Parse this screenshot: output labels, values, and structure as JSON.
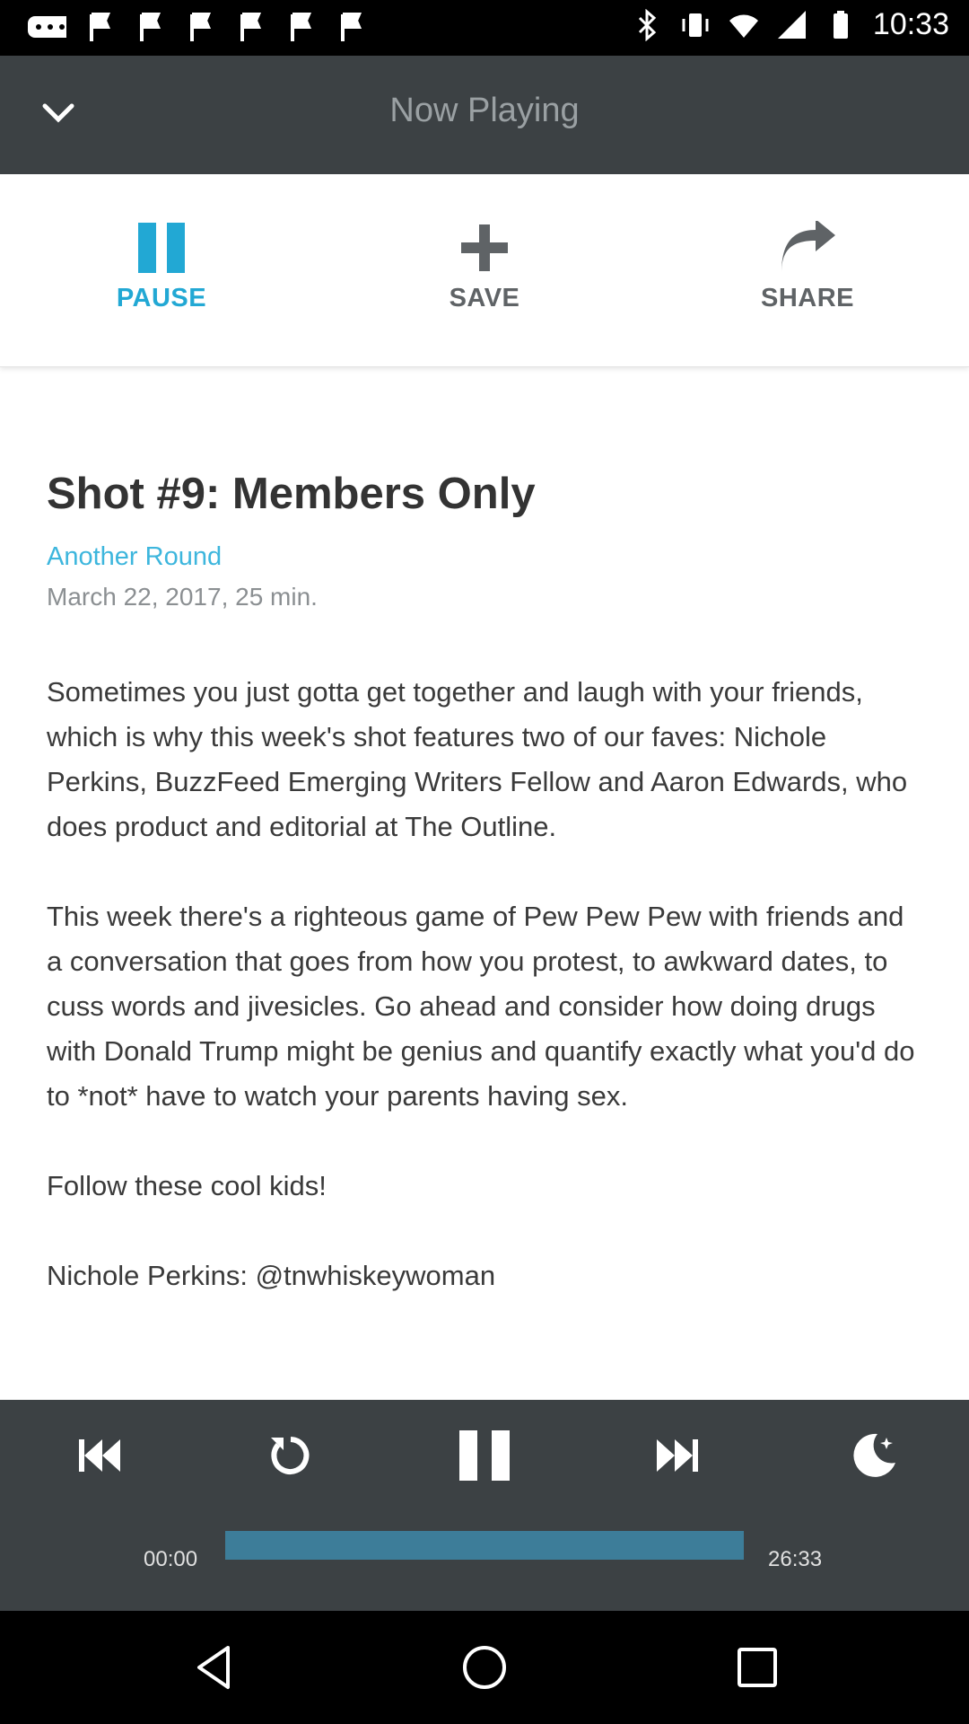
{
  "status_bar": {
    "time": "10:33"
  },
  "header": {
    "title": "Now Playing"
  },
  "actions": {
    "pause_label": "PAUSE",
    "save_label": "SAVE",
    "share_label": "SHARE"
  },
  "episode": {
    "title": "Shot #9: Members Only",
    "podcast": "Another Round",
    "meta": "March 22, 2017, 25 min.",
    "description": [
      "Sometimes you just gotta get together and laugh with your friends, which is why this week's shot features two of our faves: Nichole Perkins, BuzzFeed Emerging Writers Fellow and Aaron Edwards, who does product and editorial at The Outline.",
      "This week there's a righteous game of Pew Pew Pew with friends and a conversation that goes from how you protest, to awkward dates, to cuss words and jivesicles. Go ahead and consider how doing drugs with Donald Trump might be genius and quantify exactly what you'd do to *not* have to watch your parents having sex.",
      "Follow these cool kids!",
      "Nichole Perkins: @tnwhiskeywoman"
    ]
  },
  "player": {
    "elapsed": "00:00",
    "duration": "26:33",
    "progress_fraction": 1.0
  },
  "colors": {
    "accent": "#22a8d4",
    "header_bg": "#3c4144",
    "progress_fill": "#3d7d99"
  }
}
